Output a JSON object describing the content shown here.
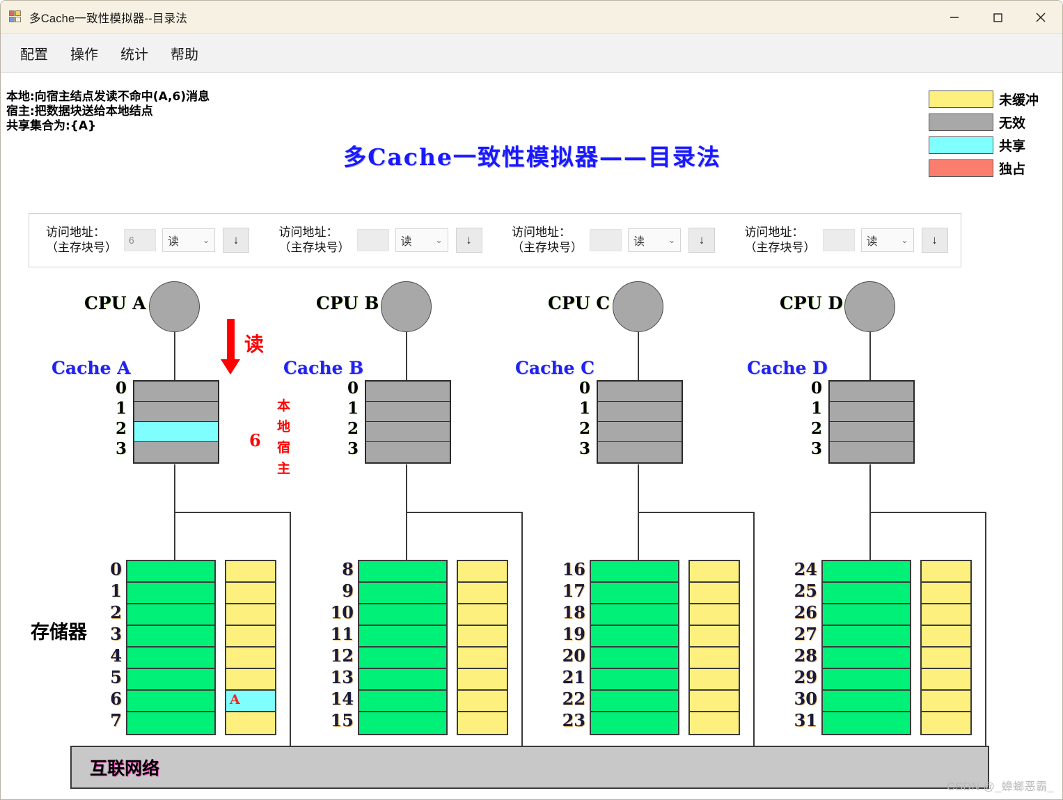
{
  "window": {
    "title": "多Cache一致性模拟器--目录法",
    "icon": "app-icon",
    "minimize_label": "—",
    "maximize_label": "□",
    "close_label": "✕"
  },
  "menubar": {
    "items": [
      {
        "label": "配置"
      },
      {
        "label": "操作"
      },
      {
        "label": "统计"
      },
      {
        "label": "帮助"
      }
    ]
  },
  "status": {
    "line1": "本地:向宿主结点发读不命中(A,6)消息",
    "line2": "宿主:把数据块送给本地结点",
    "line3": "共享集合为:{A}"
  },
  "diagram_title": "多Cache一致性模拟器——目录法",
  "legend": {
    "items": [
      {
        "label": "未缓冲",
        "color": "#fdf07f"
      },
      {
        "label": "无效",
        "color": "#a8a8a8"
      },
      {
        "label": "共享",
        "color": "#7fffff"
      },
      {
        "label": "独占",
        "color": "#fa7d6e"
      }
    ]
  },
  "controls": {
    "groups": [
      {
        "label_line1": "访问地址：",
        "label_line2": "（主存块号）",
        "value": "6",
        "placeholder": "",
        "op": "读",
        "chevron": "⌄",
        "step_label": "↓"
      },
      {
        "label_line1": "访问地址：",
        "label_line2": "（主存块号）",
        "value": "",
        "placeholder": "",
        "op": "读",
        "chevron": "⌄",
        "step_label": "↓"
      },
      {
        "label_line1": "访问地址：",
        "label_line2": "（主存块号）",
        "value": "",
        "placeholder": "",
        "op": "读",
        "chevron": "⌄",
        "step_label": "↓"
      },
      {
        "label_line1": "访问地址：",
        "label_line2": "（主存块号）",
        "value": "",
        "placeholder": "",
        "op": "读",
        "chevron": "⌄",
        "step_label": "↓"
      }
    ]
  },
  "memory_section_label": "存储器",
  "interconnect": {
    "label": "互联网络"
  },
  "annotations": {
    "read_arrow_label": "读",
    "local_label": "本地",
    "home_label": "宿主",
    "cache_block_tag": "6"
  },
  "nodes": [
    {
      "cpu_label": "CPU  A",
      "cache_label": "Cache A",
      "cache_rows": [
        {
          "index": "0",
          "state": "无效",
          "color": "#a8a8a8"
        },
        {
          "index": "1",
          "state": "无效",
          "color": "#a8a8a8"
        },
        {
          "index": "2",
          "state": "共享",
          "color": "#7fffff"
        },
        {
          "index": "3",
          "state": "无效",
          "color": "#a8a8a8"
        }
      ],
      "memory_rows": [
        {
          "index": "0",
          "color": "#00f078",
          "dir_color": "#fdf07f",
          "dir_tag": ""
        },
        {
          "index": "1",
          "color": "#00f078",
          "dir_color": "#fdf07f",
          "dir_tag": ""
        },
        {
          "index": "2",
          "color": "#00f078",
          "dir_color": "#fdf07f",
          "dir_tag": ""
        },
        {
          "index": "3",
          "color": "#00f078",
          "dir_color": "#fdf07f",
          "dir_tag": ""
        },
        {
          "index": "4",
          "color": "#00f078",
          "dir_color": "#fdf07f",
          "dir_tag": ""
        },
        {
          "index": "5",
          "color": "#00f078",
          "dir_color": "#fdf07f",
          "dir_tag": ""
        },
        {
          "index": "6",
          "color": "#00f078",
          "dir_color": "#7fffff",
          "dir_tag": "A"
        },
        {
          "index": "7",
          "color": "#00f078",
          "dir_color": "#fdf07f",
          "dir_tag": ""
        }
      ]
    },
    {
      "cpu_label": "CPU  B",
      "cache_label": "Cache B",
      "cache_rows": [
        {
          "index": "0",
          "state": "无效",
          "color": "#a8a8a8"
        },
        {
          "index": "1",
          "state": "无效",
          "color": "#a8a8a8"
        },
        {
          "index": "2",
          "state": "无效",
          "color": "#a8a8a8"
        },
        {
          "index": "3",
          "state": "无效",
          "color": "#a8a8a8"
        }
      ],
      "memory_rows": [
        {
          "index": "8",
          "color": "#00f078",
          "dir_color": "#fdf07f",
          "dir_tag": ""
        },
        {
          "index": "9",
          "color": "#00f078",
          "dir_color": "#fdf07f",
          "dir_tag": ""
        },
        {
          "index": "10",
          "color": "#00f078",
          "dir_color": "#fdf07f",
          "dir_tag": ""
        },
        {
          "index": "11",
          "color": "#00f078",
          "dir_color": "#fdf07f",
          "dir_tag": ""
        },
        {
          "index": "12",
          "color": "#00f078",
          "dir_color": "#fdf07f",
          "dir_tag": ""
        },
        {
          "index": "13",
          "color": "#00f078",
          "dir_color": "#fdf07f",
          "dir_tag": ""
        },
        {
          "index": "14",
          "color": "#00f078",
          "dir_color": "#fdf07f",
          "dir_tag": ""
        },
        {
          "index": "15",
          "color": "#00f078",
          "dir_color": "#fdf07f",
          "dir_tag": ""
        }
      ]
    },
    {
      "cpu_label": "CPU  C",
      "cache_label": "Cache C",
      "cache_rows": [
        {
          "index": "0",
          "state": "无效",
          "color": "#a8a8a8"
        },
        {
          "index": "1",
          "state": "无效",
          "color": "#a8a8a8"
        },
        {
          "index": "2",
          "state": "无效",
          "color": "#a8a8a8"
        },
        {
          "index": "3",
          "state": "无效",
          "color": "#a8a8a8"
        }
      ],
      "memory_rows": [
        {
          "index": "16",
          "color": "#00f078",
          "dir_color": "#fdf07f",
          "dir_tag": ""
        },
        {
          "index": "17",
          "color": "#00f078",
          "dir_color": "#fdf07f",
          "dir_tag": ""
        },
        {
          "index": "18",
          "color": "#00f078",
          "dir_color": "#fdf07f",
          "dir_tag": ""
        },
        {
          "index": "19",
          "color": "#00f078",
          "dir_color": "#fdf07f",
          "dir_tag": ""
        },
        {
          "index": "20",
          "color": "#00f078",
          "dir_color": "#fdf07f",
          "dir_tag": ""
        },
        {
          "index": "21",
          "color": "#00f078",
          "dir_color": "#fdf07f",
          "dir_tag": ""
        },
        {
          "index": "22",
          "color": "#00f078",
          "dir_color": "#fdf07f",
          "dir_tag": ""
        },
        {
          "index": "23",
          "color": "#00f078",
          "dir_color": "#fdf07f",
          "dir_tag": ""
        }
      ]
    },
    {
      "cpu_label": "CPU  D",
      "cache_label": "Cache D",
      "cache_rows": [
        {
          "index": "0",
          "state": "无效",
          "color": "#a8a8a8"
        },
        {
          "index": "1",
          "state": "无效",
          "color": "#a8a8a8"
        },
        {
          "index": "2",
          "state": "无效",
          "color": "#a8a8a8"
        },
        {
          "index": "3",
          "state": "无效",
          "color": "#a8a8a8"
        }
      ],
      "memory_rows": [
        {
          "index": "24",
          "color": "#00f078",
          "dir_color": "#fdf07f",
          "dir_tag": ""
        },
        {
          "index": "25",
          "color": "#00f078",
          "dir_color": "#fdf07f",
          "dir_tag": ""
        },
        {
          "index": "26",
          "color": "#00f078",
          "dir_color": "#fdf07f",
          "dir_tag": ""
        },
        {
          "index": "27",
          "color": "#00f078",
          "dir_color": "#fdf07f",
          "dir_tag": ""
        },
        {
          "index": "28",
          "color": "#00f078",
          "dir_color": "#fdf07f",
          "dir_tag": ""
        },
        {
          "index": "29",
          "color": "#00f078",
          "dir_color": "#fdf07f",
          "dir_tag": ""
        },
        {
          "index": "30",
          "color": "#00f078",
          "dir_color": "#fdf07f",
          "dir_tag": ""
        },
        {
          "index": "31",
          "color": "#00f078",
          "dir_color": "#fdf07f",
          "dir_tag": ""
        }
      ]
    }
  ],
  "watermark": "CSDN @_蟑螂恶霸_"
}
